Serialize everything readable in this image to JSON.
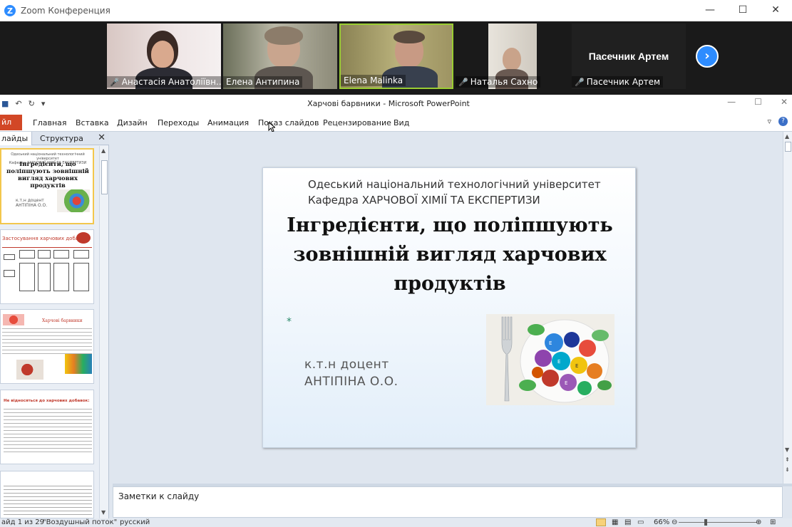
{
  "zoom": {
    "title": "Zoom Конференция",
    "window_controls": [
      "—",
      "☐",
      "✕"
    ],
    "participants": [
      {
        "name": "Анастасія Анатоліївн..."
      },
      {
        "name": "Елена Антипина"
      },
      {
        "name": "Elena Malinka"
      },
      {
        "name": "Наталья Сахно"
      },
      {
        "name": "Пасечник Артем",
        "display": "Пасечник Артем"
      }
    ],
    "next_page": "›",
    "colors": {
      "accent": "#2d8cff",
      "active_speaker": "#9acd32"
    }
  },
  "ppt": {
    "title": "Харчові барвники - Microsoft PowerPoint",
    "file_tab": "йл",
    "tabs": [
      "Главная",
      "Вставка",
      "Дизайн",
      "Переходы",
      "Анимация",
      "Показ слайдов",
      "Рецензирование",
      "Вид"
    ],
    "panel_tabs": {
      "slides": "лайды",
      "outline": "Структура"
    },
    "slide": {
      "university": "Одеський національний технологічний університет",
      "department": "Кафедра ХАРЧОВОЇ  ХІМІЇ ТА ЕКСПЕРТИЗИ",
      "title": "Інгредієнти, що поліпшують зовнішній вигляд харчових продуктів",
      "marker": "*",
      "author_line1": "к.т.н доцент",
      "author_line2": "АНТІПІНА О.О."
    },
    "thumbnails": {
      "t1_title": "Інгредієнти, що поліпшують зовнішній вигляд харчових продуктів",
      "t2_title": "Застосування харчових добавок",
      "t3_title": "Харчові барвники",
      "t4_title": "Не відносяться до харчових добавок:"
    },
    "notes_placeholder": "Заметки к слайду",
    "status": {
      "slide_counter": "айд 1 из 29",
      "theme": "\"Воздушный поток\"",
      "language": "русский",
      "zoom": "66%"
    }
  }
}
